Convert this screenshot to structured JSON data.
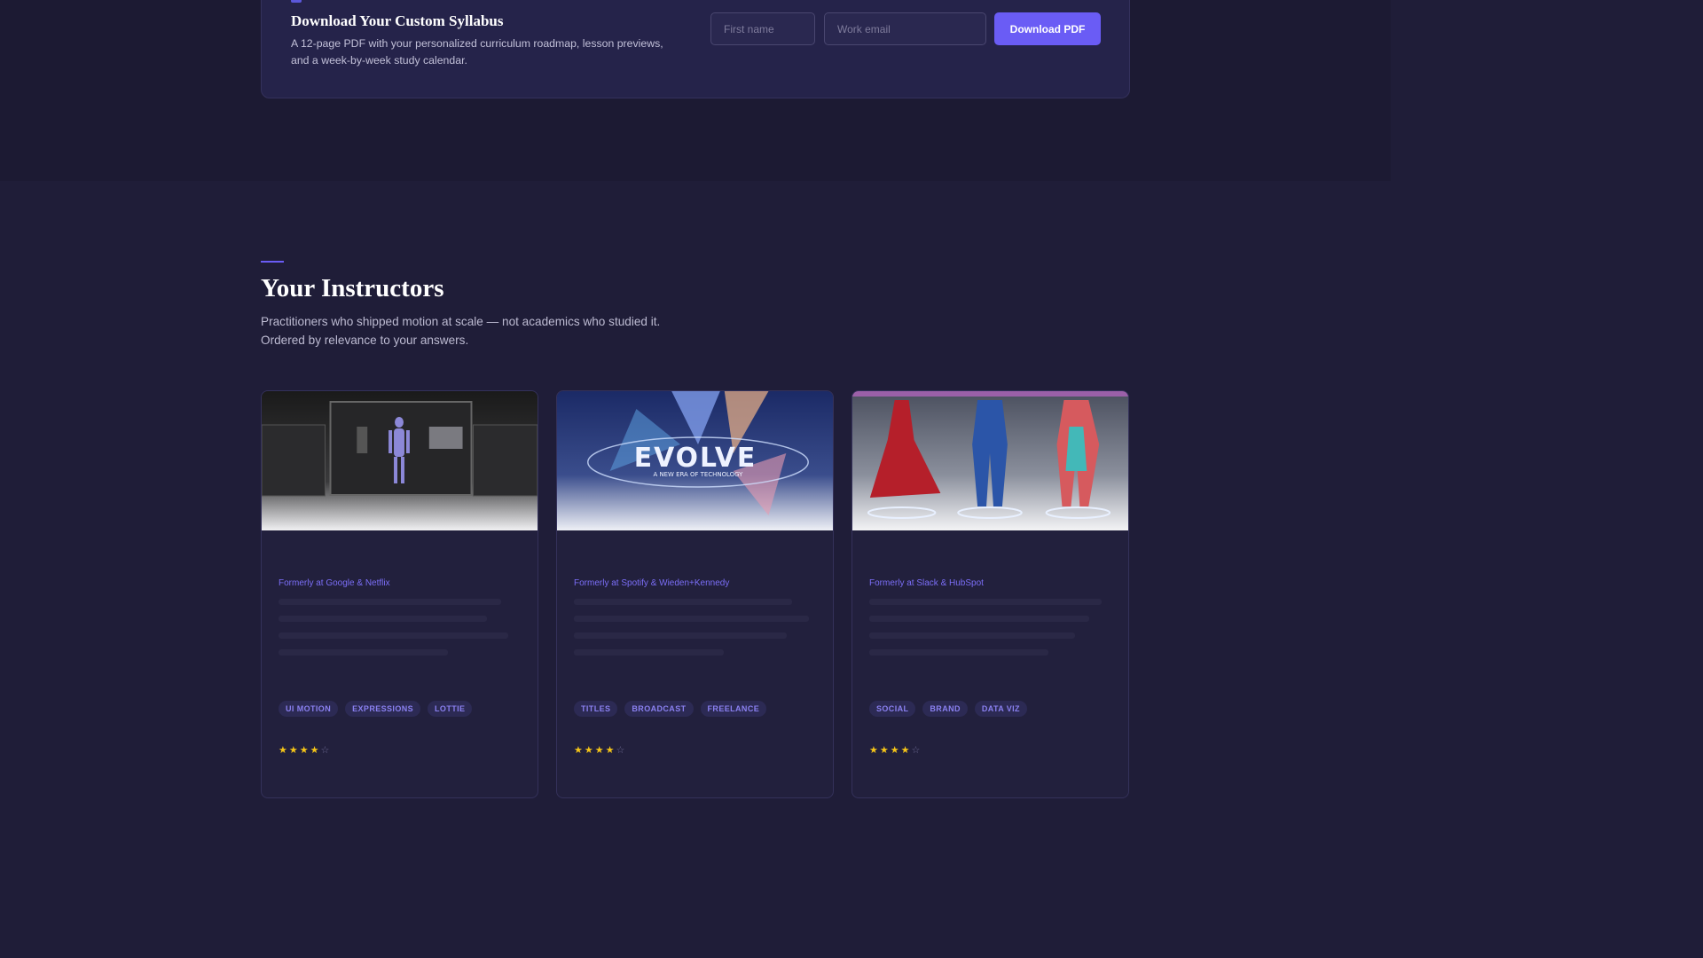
{
  "syllabus": {
    "title": "Download Your Custom Syllabus",
    "description": "A 12-page PDF with your personalized curriculum roadmap, lesson previews, and a week-by-week study calendar.",
    "first_name_placeholder": "First name",
    "email_placeholder": "Work email",
    "button_label": "Download PDF"
  },
  "instructors": {
    "title": "Your Instructors",
    "subtitle": "Practitioners who shipped motion at scale — not academics who studied it. Ordered by relevance to your answers.",
    "cards": [
      {
        "former": "Formerly at Google & Netflix",
        "tags": [
          "UI MOTION",
          "EXPRESSIONS",
          "LOTTIE"
        ],
        "rating_stars": 4,
        "image": "animation-workstation-image"
      },
      {
        "former": "Formerly at Spotify & Wieden+Kennedy",
        "tags": [
          "TITLES",
          "BROADCAST",
          "FREELANCE"
        ],
        "rating_stars": 4,
        "image": "evolve-title-image",
        "image_text": "EVOLVE",
        "image_subtext": "A NEW ERA OF TECHNOLOGY"
      },
      {
        "former": "Formerly at Slack & HubSpot",
        "tags": [
          "SOCIAL",
          "BRAND",
          "DATA VIZ"
        ],
        "rating_stars": 4,
        "image": "fashion-3d-image"
      }
    ]
  },
  "colors": {
    "accent": "#6a5cf5",
    "star": "#f5c518",
    "background": "#1f1d38"
  }
}
